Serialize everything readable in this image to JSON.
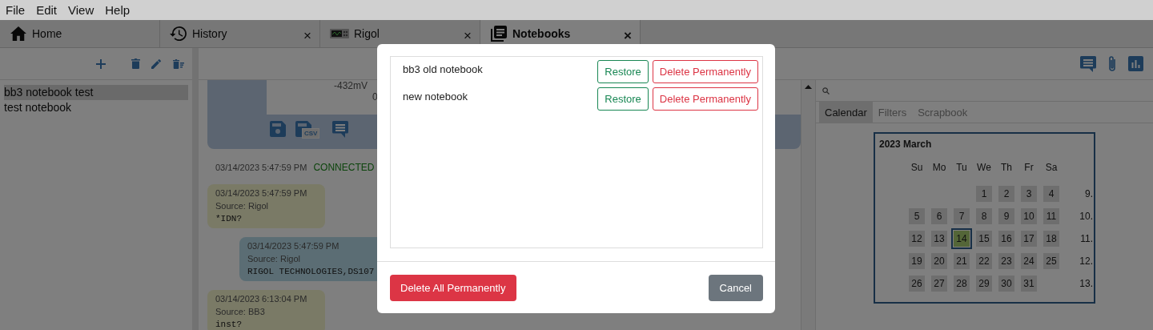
{
  "menu": [
    "File",
    "Edit",
    "View",
    "Help"
  ],
  "tabs": [
    {
      "label": "Home",
      "closable": false,
      "selected": false
    },
    {
      "label": "History",
      "closable": true,
      "selected": false
    },
    {
      "label": "Rigol",
      "closable": true,
      "selected": false
    },
    {
      "label": "Notebooks",
      "closable": true,
      "selected": true
    }
  ],
  "close_glyph": "×",
  "sidebar": {
    "items": [
      {
        "label": "bb3 notebook test",
        "selected": true
      },
      {
        "label": "test notebook",
        "selected": false
      }
    ]
  },
  "history": {
    "card": {
      "readings": [
        "-432mV",
        "0"
      ],
      "csv_badge": "CSV"
    },
    "entries": [
      {
        "kind": "status",
        "time": "03/14/2023 5:47:59 PM",
        "text": "CONNECTED"
      },
      {
        "kind": "received",
        "time": "03/14/2023 5:47:59 PM",
        "source": "Source: Rigol",
        "text": "*IDN?"
      },
      {
        "kind": "sent",
        "time": "03/14/2023 5:47:59 PM",
        "source": "Source: Rigol",
        "text": "RIGOL TECHNOLOGIES,DS107"
      },
      {
        "kind": "received",
        "time": "03/14/2023 6:13:04 PM",
        "source": "Source: BB3",
        "text": "inst?"
      }
    ]
  },
  "right_panel": {
    "tabs": [
      {
        "label": "Calendar",
        "selected": true
      },
      {
        "label": "Filters",
        "selected": false
      },
      {
        "label": "Scrapbook",
        "selected": false
      }
    ],
    "calendar": {
      "title": "2023 March",
      "weekdays": [
        "Su",
        "Mo",
        "Tu",
        "We",
        "Th",
        "Fr",
        "Sa"
      ],
      "weeks": [
        {
          "number": "9.",
          "days": [
            {
              "day": "1",
              "selected": false
            },
            {
              "day": "2",
              "selected": false
            },
            {
              "day": "3",
              "selected": false
            },
            {
              "day": "4",
              "selected": false
            }
          ]
        },
        {
          "number": "10.",
          "days": [
            {
              "day": "5",
              "selected": false
            },
            {
              "day": "6",
              "selected": false
            },
            {
              "day": "7",
              "selected": false
            },
            {
              "day": "8",
              "selected": false
            },
            {
              "day": "9",
              "selected": false
            },
            {
              "day": "10",
              "selected": false
            },
            {
              "day": "11",
              "selected": false
            }
          ]
        },
        {
          "number": "11.",
          "days": [
            {
              "day": "12",
              "selected": false
            },
            {
              "day": "13",
              "selected": false
            },
            {
              "day": "14",
              "selected": true
            },
            {
              "day": "15",
              "selected": false
            },
            {
              "day": "16",
              "selected": false
            },
            {
              "day": "17",
              "selected": false
            },
            {
              "day": "18",
              "selected": false
            }
          ]
        },
        {
          "number": "12.",
          "days": [
            {
              "day": "19",
              "selected": false
            },
            {
              "day": "20",
              "selected": false
            },
            {
              "day": "21",
              "selected": false
            },
            {
              "day": "22",
              "selected": false
            },
            {
              "day": "23",
              "selected": false
            },
            {
              "day": "24",
              "selected": false
            },
            {
              "day": "25",
              "selected": false
            }
          ]
        },
        {
          "number": "13.",
          "days": [
            {
              "day": "26",
              "selected": false
            },
            {
              "day": "27",
              "selected": false
            },
            {
              "day": "28",
              "selected": false
            },
            {
              "day": "29",
              "selected": false
            },
            {
              "day": "30",
              "selected": false
            },
            {
              "day": "31",
              "selected": false
            }
          ]
        }
      ]
    }
  },
  "dialog": {
    "notebooks": [
      {
        "name": "bb3 old notebook",
        "restore": "Restore",
        "delete": "Delete Permanently"
      },
      {
        "name": "new notebook",
        "restore": "Restore",
        "delete": "Delete Permanently"
      }
    ],
    "delete_all": "Delete All Permanently",
    "cancel": "Cancel"
  }
}
